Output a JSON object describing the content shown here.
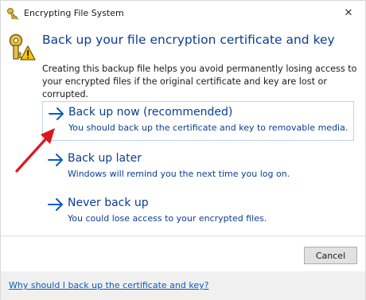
{
  "window": {
    "title": "Encrypting File System",
    "close_symbol": "✕"
  },
  "header": {
    "heading": "Back up your file encryption certificate and key",
    "description": "Creating this backup file helps you avoid permanently losing access to your encrypted files if the original certificate and key are lost or corrupted.",
    "icon": "key-warning-icon"
  },
  "options": [
    {
      "title": "Back up now (recommended)",
      "subtitle": "You should back up the certificate and key to removable media.",
      "selected": true
    },
    {
      "title": "Back up later",
      "subtitle": "Windows will remind you the next time you log on.",
      "selected": false
    },
    {
      "title": "Never back up",
      "subtitle": "You could lose access to your encrypted files.",
      "selected": false
    }
  ],
  "buttons": {
    "cancel_label": "Cancel"
  },
  "footer": {
    "help_link": "Why should I back up the certificate and key?"
  },
  "colors": {
    "heading": "#0b3d91",
    "link": "#0b5bc4",
    "annotation_arrow": "#e0161c"
  }
}
